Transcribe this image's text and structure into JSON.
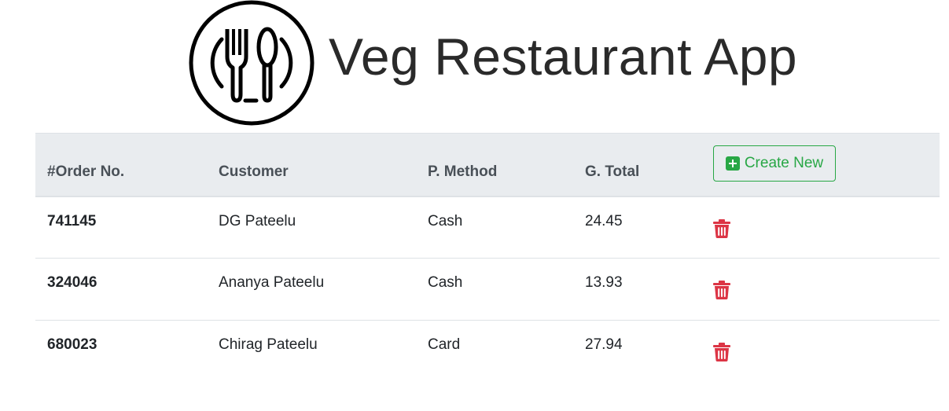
{
  "app": {
    "title": "Veg Restaurant App",
    "logo_icon": "fork-spoon-plate-icon"
  },
  "table": {
    "headers": [
      "#Order No.",
      "Customer",
      "P. Method",
      "G. Total"
    ],
    "create_button": {
      "label": "Create New",
      "icon": "plus-square-icon"
    },
    "rows": [
      {
        "order_no": "741145",
        "customer": "DG Pateelu",
        "method": "Cash",
        "total": "24.45"
      },
      {
        "order_no": "324046",
        "customer": "Ananya Pateelu",
        "method": "Cash",
        "total": "13.93"
      },
      {
        "order_no": "680023",
        "customer": "Chirag Pateelu",
        "method": "Card",
        "total": "27.94"
      }
    ],
    "delete_icon": "trash-icon"
  },
  "colors": {
    "primary_green": "#28a745",
    "danger_red": "#dc3545",
    "header_bg": "#e9ecef"
  }
}
